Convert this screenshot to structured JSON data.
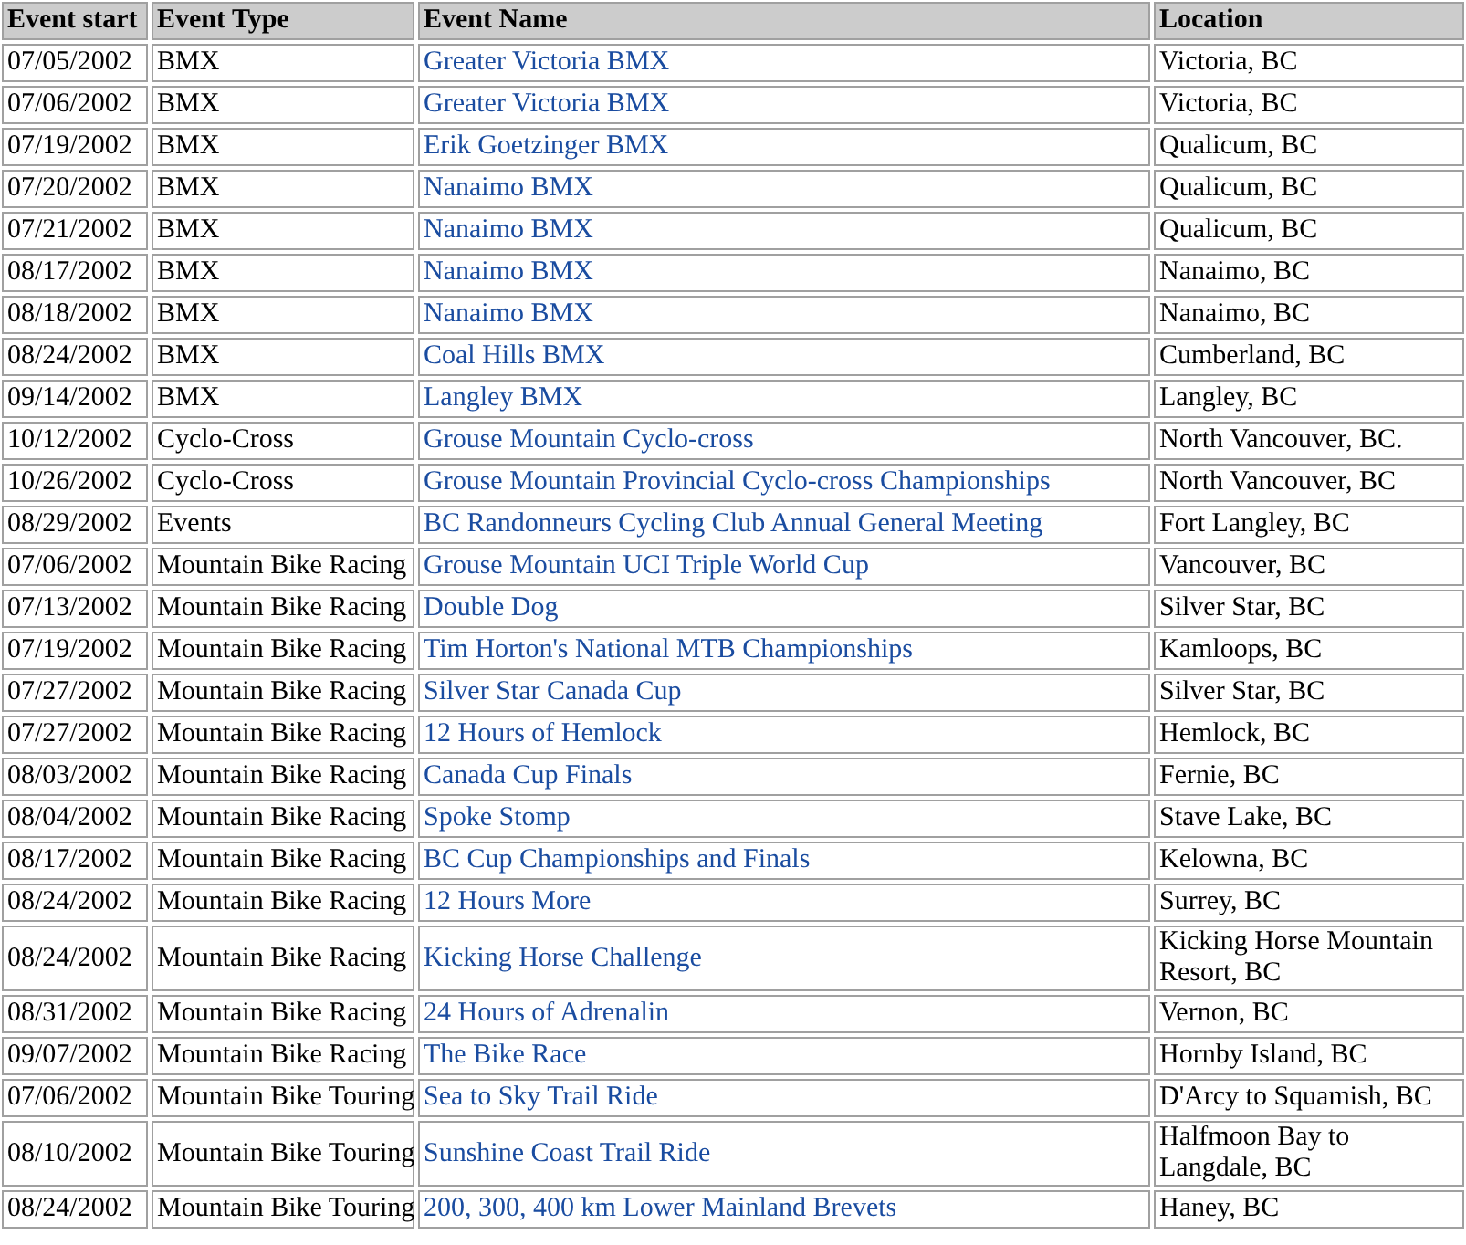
{
  "table": {
    "columns": [
      "Event start",
      "Event Type",
      "Event Name",
      "Location"
    ],
    "rows": [
      {
        "start": "07/05/2002",
        "type": "BMX",
        "name": "Greater Victoria BMX",
        "location": "Victoria, BC"
      },
      {
        "start": "07/06/2002",
        "type": "BMX",
        "name": "Greater Victoria BMX",
        "location": "Victoria, BC"
      },
      {
        "start": "07/19/2002",
        "type": "BMX",
        "name": "Erik Goetzinger BMX",
        "location": "Qualicum, BC"
      },
      {
        "start": "07/20/2002",
        "type": "BMX",
        "name": "Nanaimo BMX",
        "location": "Qualicum, BC"
      },
      {
        "start": "07/21/2002",
        "type": "BMX",
        "name": "Nanaimo BMX",
        "location": "Qualicum, BC"
      },
      {
        "start": "08/17/2002",
        "type": "BMX",
        "name": "Nanaimo BMX",
        "location": "Nanaimo, BC"
      },
      {
        "start": "08/18/2002",
        "type": "BMX",
        "name": "Nanaimo BMX",
        "location": "Nanaimo, BC"
      },
      {
        "start": "08/24/2002",
        "type": "BMX",
        "name": "Coal Hills BMX",
        "location": "Cumberland, BC"
      },
      {
        "start": "09/14/2002",
        "type": "BMX",
        "name": "Langley BMX",
        "location": "Langley, BC"
      },
      {
        "start": "10/12/2002",
        "type": "Cyclo-Cross",
        "name": "Grouse Mountain Cyclo-cross",
        "location": "North Vancouver, BC."
      },
      {
        "start": "10/26/2002",
        "type": "Cyclo-Cross",
        "name": "Grouse Mountain Provincial Cyclo-cross Championships",
        "location": "North Vancouver, BC"
      },
      {
        "start": "08/29/2002",
        "type": "Events",
        "name": "BC Randonneurs Cycling Club Annual General Meeting",
        "location": "Fort Langley, BC"
      },
      {
        "start": "07/06/2002",
        "type": "Mountain Bike Racing",
        "name": "Grouse Mountain UCI Triple World Cup",
        "location": "Vancouver, BC"
      },
      {
        "start": "07/13/2002",
        "type": "Mountain Bike Racing",
        "name": "Double Dog",
        "location": "Silver Star, BC"
      },
      {
        "start": "07/19/2002",
        "type": "Mountain Bike Racing",
        "name": "Tim Horton's National MTB Championships",
        "location": "Kamloops, BC"
      },
      {
        "start": "07/27/2002",
        "type": "Mountain Bike Racing",
        "name": "Silver Star Canada Cup",
        "location": "Silver Star, BC"
      },
      {
        "start": "07/27/2002",
        "type": "Mountain Bike Racing",
        "name": "12 Hours of Hemlock",
        "location": "Hemlock, BC"
      },
      {
        "start": "08/03/2002",
        "type": "Mountain Bike Racing",
        "name": "Canada Cup Finals",
        "location": "Fernie, BC"
      },
      {
        "start": "08/04/2002",
        "type": "Mountain Bike Racing",
        "name": "Spoke Stomp",
        "location": "Stave Lake, BC"
      },
      {
        "start": "08/17/2002",
        "type": "Mountain Bike Racing",
        "name": "BC Cup Championships and Finals",
        "location": "Kelowna, BC"
      },
      {
        "start": "08/24/2002",
        "type": "Mountain Bike Racing",
        "name": "12 Hours More",
        "location": "Surrey, BC"
      },
      {
        "start": "08/24/2002",
        "type": "Mountain Bike Racing",
        "name": "Kicking Horse Challenge",
        "location": "Kicking Horse Mountain Resort, BC"
      },
      {
        "start": "08/31/2002",
        "type": "Mountain Bike Racing",
        "name": "24 Hours of Adrenalin",
        "location": "Vernon, BC"
      },
      {
        "start": "09/07/2002",
        "type": "Mountain Bike Racing",
        "name": "The Bike Race",
        "location": "Hornby Island, BC"
      },
      {
        "start": "07/06/2002",
        "type": "Mountain Bike Touring",
        "name": "Sea to Sky Trail Ride",
        "location": "D'Arcy to Squamish, BC"
      },
      {
        "start": "08/10/2002",
        "type": "Mountain Bike Touring",
        "name": "Sunshine Coast Trail Ride",
        "location": "Halfmoon Bay to Langdale, BC"
      },
      {
        "start": "08/24/2002",
        "type": "Mountain Bike Touring",
        "name": "200, 300, 400 km Lower Mainland Brevets",
        "location": "Haney, BC"
      }
    ]
  }
}
